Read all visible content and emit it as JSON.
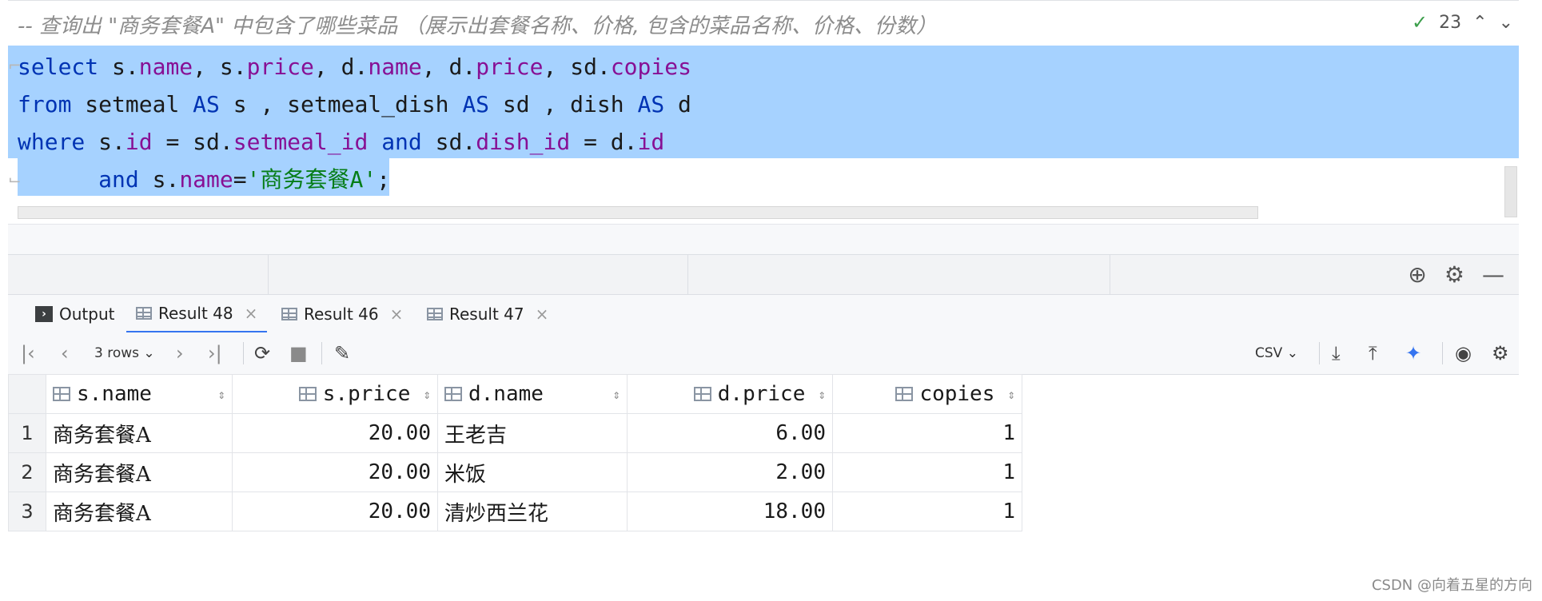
{
  "editor": {
    "comment": "-- 查询出 \"商务套餐A\" 中包含了哪些菜品 （展示出套餐名称、价格, 包含的菜品名称、价格、份数）",
    "inspection_count": "23",
    "line1": {
      "kw": "select",
      "t1": " s.",
      "f1": "name",
      "t2": ", s.",
      "f2": "price",
      "t3": ", d.",
      "f3": "name",
      "t4": ", d.",
      "f4": "price",
      "t5": ", sd.",
      "f5": "copies"
    },
    "line2": {
      "kw1": "from",
      "t1": " setmeal ",
      "kw2": "AS",
      "t2": " s , setmeal_dish ",
      "kw3": "AS",
      "t3": " sd , dish ",
      "kw4": "AS",
      "t4": " d"
    },
    "line3": {
      "kw1": "where",
      "t1": " s.",
      "f1": "id",
      "t2": " = sd.",
      "f2": "setmeal_id",
      "t3": " ",
      "kw2": "and",
      "t4": " sd.",
      "f3": "dish_id",
      "t5": " = d.",
      "f4": "id"
    },
    "line4": {
      "indent": "      ",
      "kw": "and",
      "t1": " s.",
      "f1": "name",
      "t2": "=",
      "str": "'商务套餐A'",
      "t3": ";"
    }
  },
  "tabs": [
    {
      "label": "Output",
      "icon": "output-icon"
    },
    {
      "label": "Result 48",
      "icon": "table-icon",
      "active": true
    },
    {
      "label": "Result 46",
      "icon": "table-icon"
    },
    {
      "label": "Result 47",
      "icon": "table-icon"
    }
  ],
  "toolbar": {
    "rows_label": "3 rows",
    "format_label": "CSV"
  },
  "grid": {
    "columns": [
      "s.name",
      "s.price",
      "d.name",
      "d.price",
      "copies"
    ],
    "rows": [
      {
        "n": "1",
        "s_name": "商务套餐A",
        "s_price": "20.00",
        "d_name": "王老吉",
        "d_price": "6.00",
        "copies": "1"
      },
      {
        "n": "2",
        "s_name": "商务套餐A",
        "s_price": "20.00",
        "d_name": "米饭",
        "d_price": "2.00",
        "copies": "1"
      },
      {
        "n": "3",
        "s_name": "商务套餐A",
        "s_price": "20.00",
        "d_name": "清炒西兰花",
        "d_price": "18.00",
        "copies": "1"
      }
    ]
  },
  "watermark": "CSDN @向着五星的方向",
  "colors": {
    "selection": "#a6d2ff",
    "keyword": "#0033b3",
    "field": "#871094",
    "string": "#067d17",
    "accent": "#3574f0"
  }
}
